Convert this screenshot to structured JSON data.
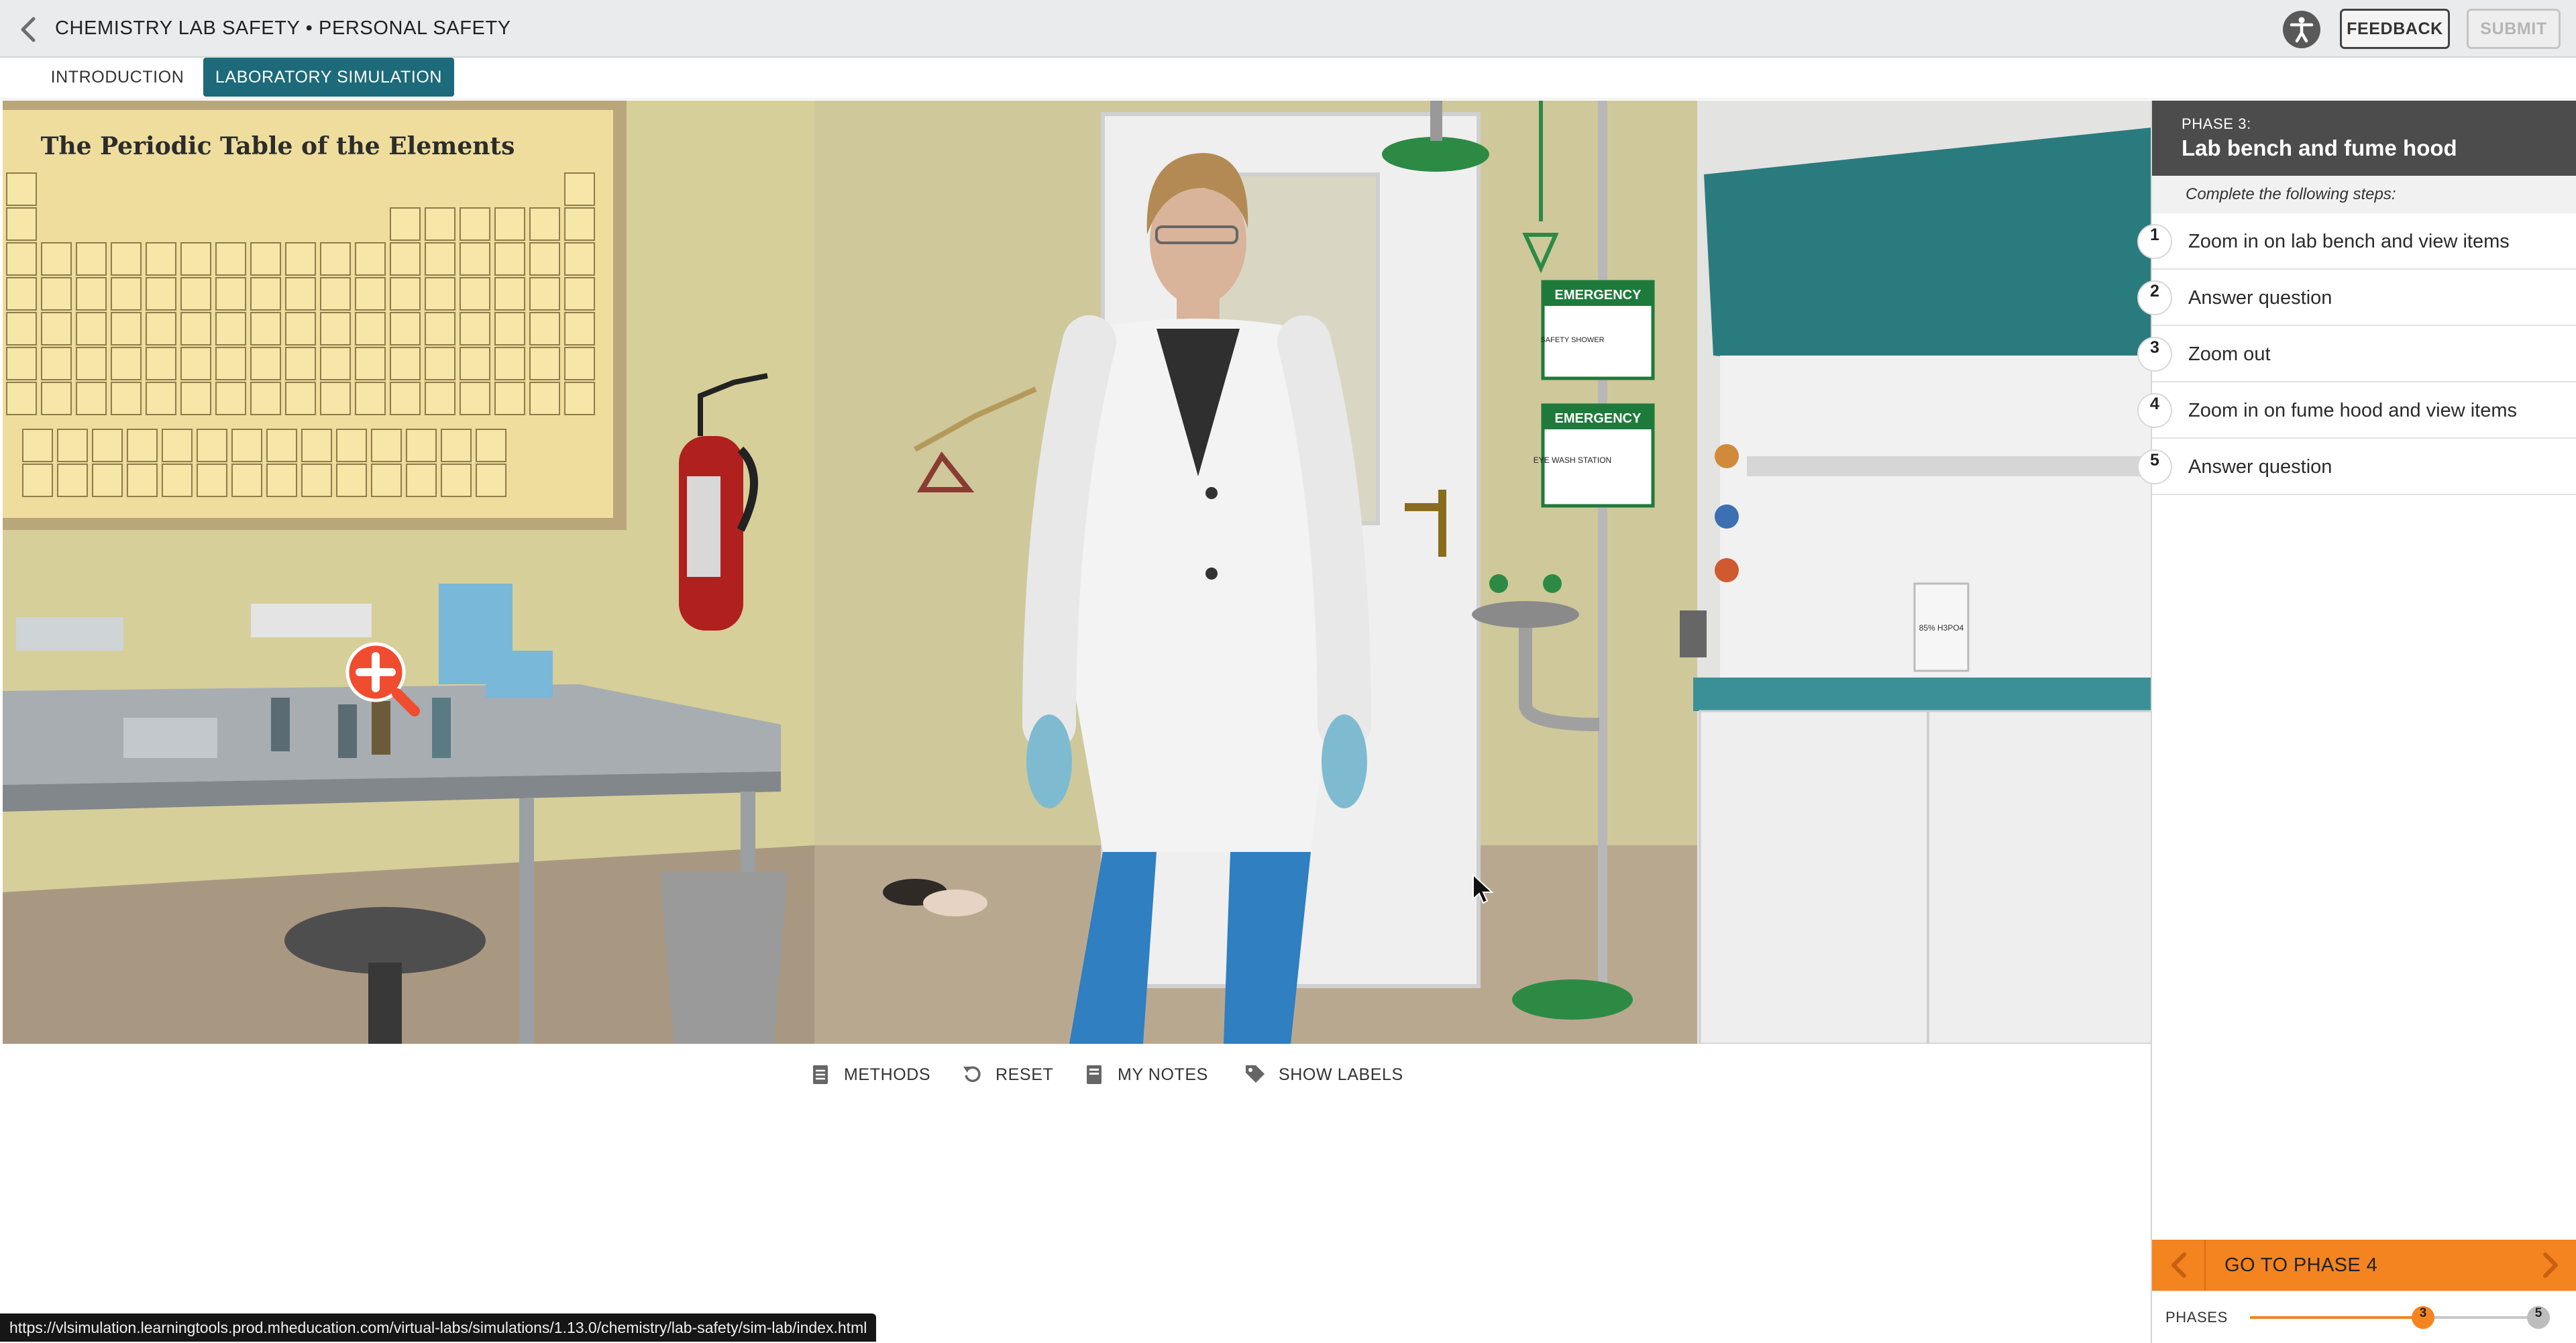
{
  "header": {
    "title": "CHEMISTRY LAB SAFETY • PERSONAL SAFETY",
    "feedback_label": "FEEDBACK",
    "submit_label": "SUBMIT"
  },
  "tabs": [
    {
      "label": "INTRODUCTION",
      "active": false
    },
    {
      "label": "LABORATORY SIMULATION",
      "active": true
    }
  ],
  "scene": {
    "periodic_title": "The Periodic Table of the Elements",
    "sign_shower_title": "EMERGENCY",
    "sign_shower_text": "SAFETY SHOWER",
    "sign_eyewash_title": "EMERGENCY",
    "sign_eyewash_text": "EYE WASH STATION",
    "bottle_label": "85% H3PO4"
  },
  "toolbar": {
    "methods_label": "METHODS",
    "reset_label": "RESET",
    "notes_label": "MY NOTES",
    "labels_label": "SHOW LABELS"
  },
  "panel": {
    "phase_label": "PHASE 3:",
    "phase_title": "Lab bench and fume hood",
    "steps_intro": "Complete the following steps:",
    "steps": [
      {
        "num": "1",
        "text": "Zoom in on lab bench and view items"
      },
      {
        "num": "2",
        "text": "Answer question"
      },
      {
        "num": "3",
        "text": "Zoom out"
      },
      {
        "num": "4",
        "text": "Zoom in on fume hood and view items"
      },
      {
        "num": "5",
        "text": "Answer question"
      }
    ],
    "go_label": "GO TO PHASE 4",
    "phases_label": "PHASES",
    "current_phase": "3",
    "total_phases": "5",
    "phase_progress": 0.6
  },
  "status_url": "https://vlsimulation.learningtools.prod.mheducation.com/virtual-labs/simulations/1.13.0/chemistry/lab-safety/sim-lab/index.html",
  "colors": {
    "accent_teal": "#1c6a7a",
    "accent_orange": "#f48420",
    "panel_header": "#4c4c4c"
  }
}
